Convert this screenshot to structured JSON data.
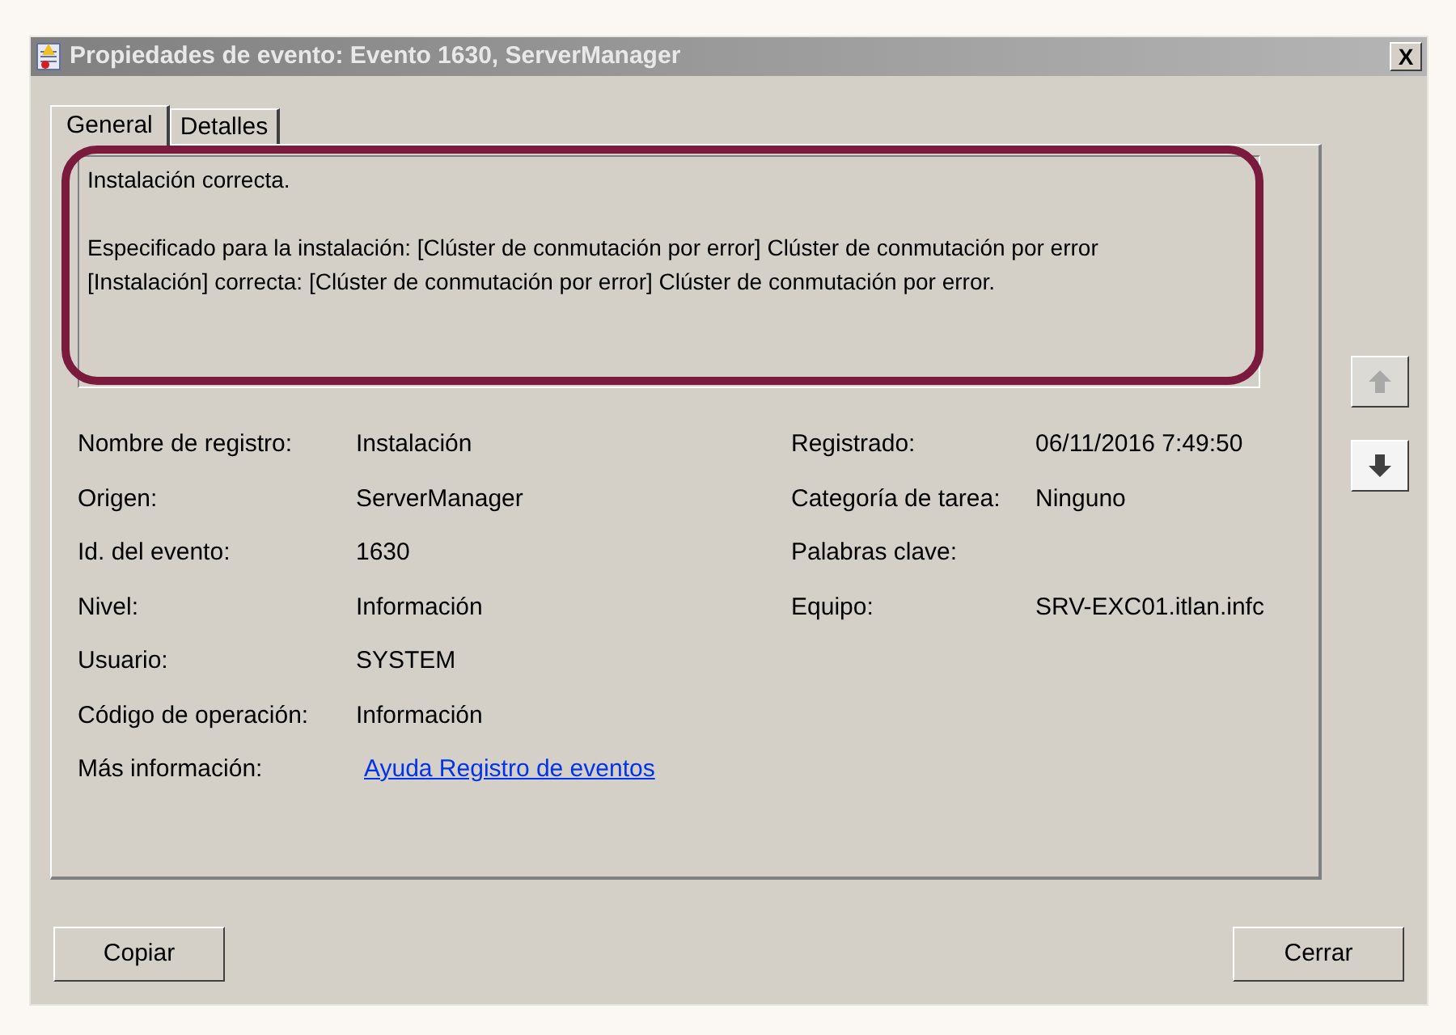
{
  "window": {
    "title": "Propiedades de evento: Evento 1630, ServerManager",
    "close": "X"
  },
  "tabs": [
    {
      "label": "General",
      "selected": true
    },
    {
      "label": "Detalles",
      "selected": false
    }
  ],
  "description": "Instalación correcta.\n\nEspecificado para la instalación: [Clúster de conmutación por error] Clúster de conmutación por error\n[Instalación] correcta: [Clúster de conmutación por error] Clúster de conmutación por error.",
  "fields_left": [
    {
      "label": "Nombre de registro:",
      "value": "Instalación"
    },
    {
      "label": "Origen:",
      "value": "ServerManager"
    },
    {
      "label": "Id. del evento:",
      "value": "1630"
    },
    {
      "label": "Nivel:",
      "value": "Información"
    },
    {
      "label": "Usuario:",
      "value": "SYSTEM"
    },
    {
      "label": "Código de operación:",
      "value": "Información"
    },
    {
      "label": "Más información:",
      "value": "Ayuda Registro de eventos",
      "kind": "link"
    }
  ],
  "fields_right": [
    {
      "label": "Registrado:",
      "value": "06/11/2016 7:49:50"
    },
    {
      "label": "Categoría de tarea:",
      "value": "Ninguno"
    },
    {
      "label": "Palabras clave:"
    },
    {
      "label": "Equipo:",
      "value": "SRV-EXC01.itlan.infc"
    }
  ],
  "nav": {
    "up_disabled": true,
    "down_disabled": false
  },
  "buttons": [
    "Copiar",
    "Cerrar"
  ]
}
